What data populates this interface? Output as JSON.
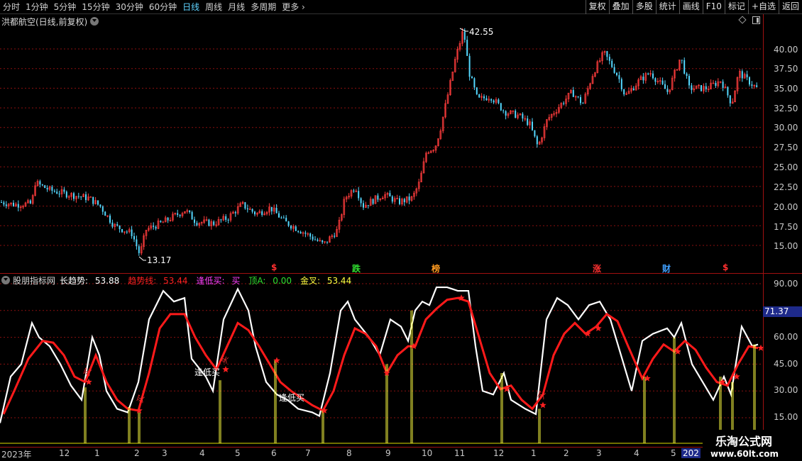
{
  "toolbar": {
    "periods": [
      "分时",
      "1分钟",
      "5分钟",
      "15分钟",
      "30分钟",
      "60分钟",
      "日线",
      "周线",
      "月线",
      "多周期",
      "更多"
    ],
    "active_period": "日线",
    "right_buttons": [
      "复权",
      "叠加",
      "多股",
      "统计",
      "画线",
      "F10",
      "标记",
      "+自选",
      "返回"
    ]
  },
  "price_panel": {
    "title": "洪都航空(日线,前复权)",
    "high_label": "42.55",
    "low_label": "13.17",
    "y_ticks": [
      "40.00",
      "37.50",
      "35.00",
      "32.50",
      "30.00",
      "27.50",
      "25.00",
      "22.50",
      "20.00",
      "17.50",
      "15.00"
    ],
    "event_markers": [
      {
        "text": "$",
        "color": "#ff3030"
      },
      {
        "text": "跌",
        "color": "#30e030"
      },
      {
        "text": "榜",
        "color": "#ff9a20"
      },
      {
        "text": "涨",
        "color": "#ff3030"
      },
      {
        "text": "财",
        "color": "#40a0ff"
      },
      {
        "text": "$",
        "color": "#ff3030"
      }
    ]
  },
  "indicator_panel": {
    "name": "股朋指标网",
    "fields": [
      {
        "label": "长趋势:",
        "value": "53.88",
        "color": "#ffffff"
      },
      {
        "label": "趋势线:",
        "value": "53.44",
        "color": "#ff2020"
      },
      {
        "label": "逢低买:",
        "value": "买",
        "color": "#ff40ff"
      },
      {
        "label": "顶A:",
        "value": "0.00",
        "color": "#30e030"
      },
      {
        "label": "金叉:",
        "value": "53.44",
        "color": "#ffff40"
      }
    ],
    "y_ticks": [
      "90.00",
      "75.00",
      "60.00",
      "45.00",
      "30.00",
      "15.00"
    ],
    "current_value": "71.37",
    "labels": [
      "逢低买",
      "逢低买"
    ],
    "buy_marks": [
      "买",
      "买",
      "买",
      "买"
    ]
  },
  "date_axis": {
    "ticks": [
      "2023年",
      "12",
      "1",
      "2",
      "3",
      "4",
      "5",
      "6",
      "7",
      "8",
      "9",
      "10",
      "11",
      "12",
      "1",
      "2",
      "3",
      "4",
      "5",
      "202"
    ]
  },
  "watermark": {
    "title": "乐淘公式网",
    "url": "www.60lt.com"
  },
  "colors": {
    "up": "#ff3c3c",
    "down": "#54d8ff",
    "long_trend": "#ffffff",
    "trend_line": "#ff1a1a",
    "golden": "#ffff40",
    "grid": "#8a1010"
  }
}
